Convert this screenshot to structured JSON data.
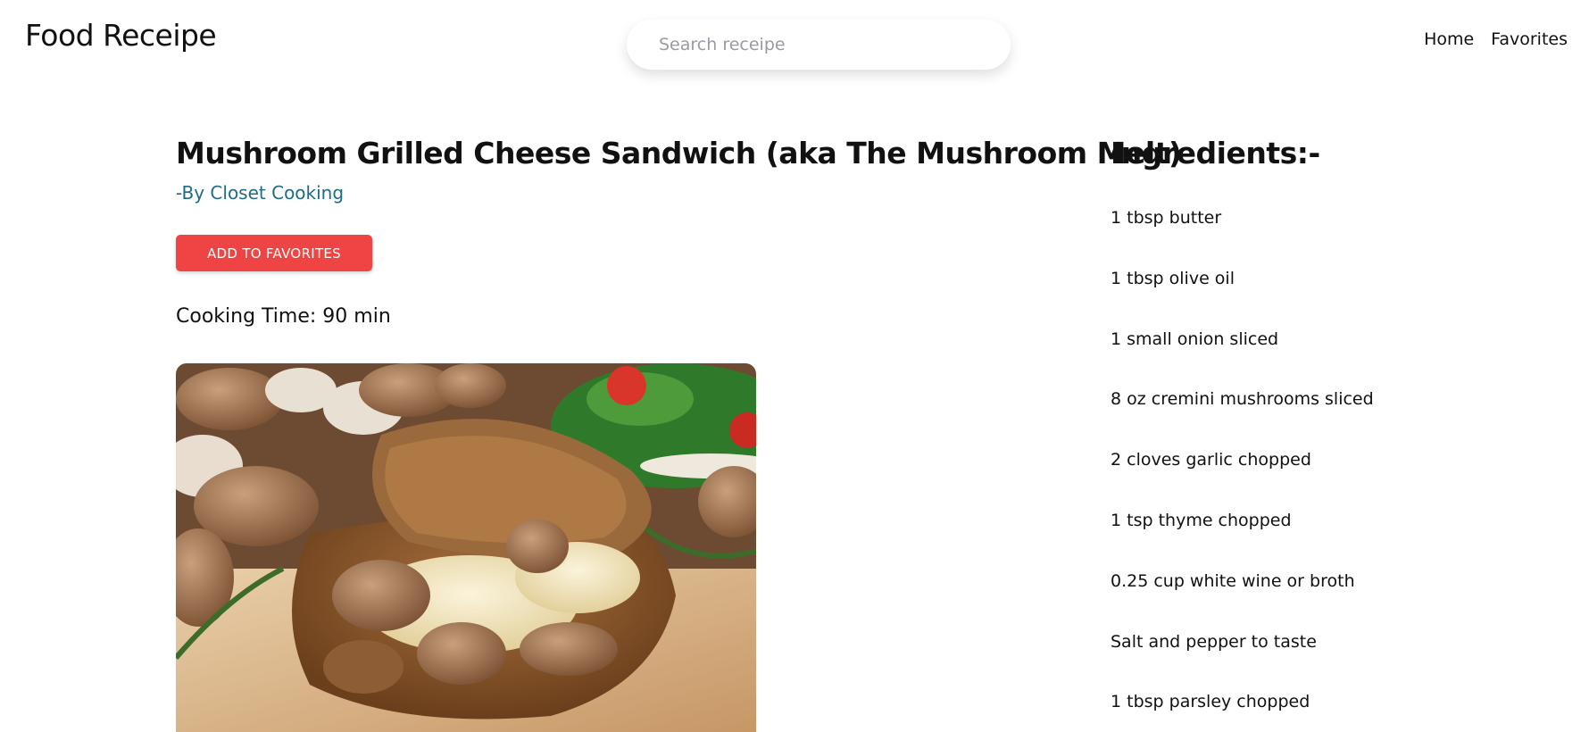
{
  "header": {
    "brand": "Food Receipe",
    "search_placeholder": "Search receipe",
    "nav": [
      {
        "label": "Home"
      },
      {
        "label": "Favorites"
      }
    ]
  },
  "recipe": {
    "title": "Mushroom Grilled Cheese Sandwich (aka The Mushroom Melt)",
    "author": "-By Closet Cooking",
    "add_favorites_label": "ADD TO FAVORITES",
    "cooking_time_label": "Cooking Time:",
    "cooking_time_value": "90 min",
    "image_icon": "food-photo"
  },
  "ingredients": {
    "title": "Ingredients:-",
    "items": [
      "1 tbsp butter",
      "1 tbsp olive oil",
      "1 small onion sliced",
      "8 oz cremini mushrooms sliced",
      "2 cloves garlic chopped",
      "1 tsp thyme chopped",
      "0.25 cup white wine or broth",
      "Salt and pepper to taste",
      "1 tbsp parsley chopped"
    ]
  },
  "colors": {
    "accent_button": "#ef4444",
    "author_link": "#1e6b86"
  }
}
